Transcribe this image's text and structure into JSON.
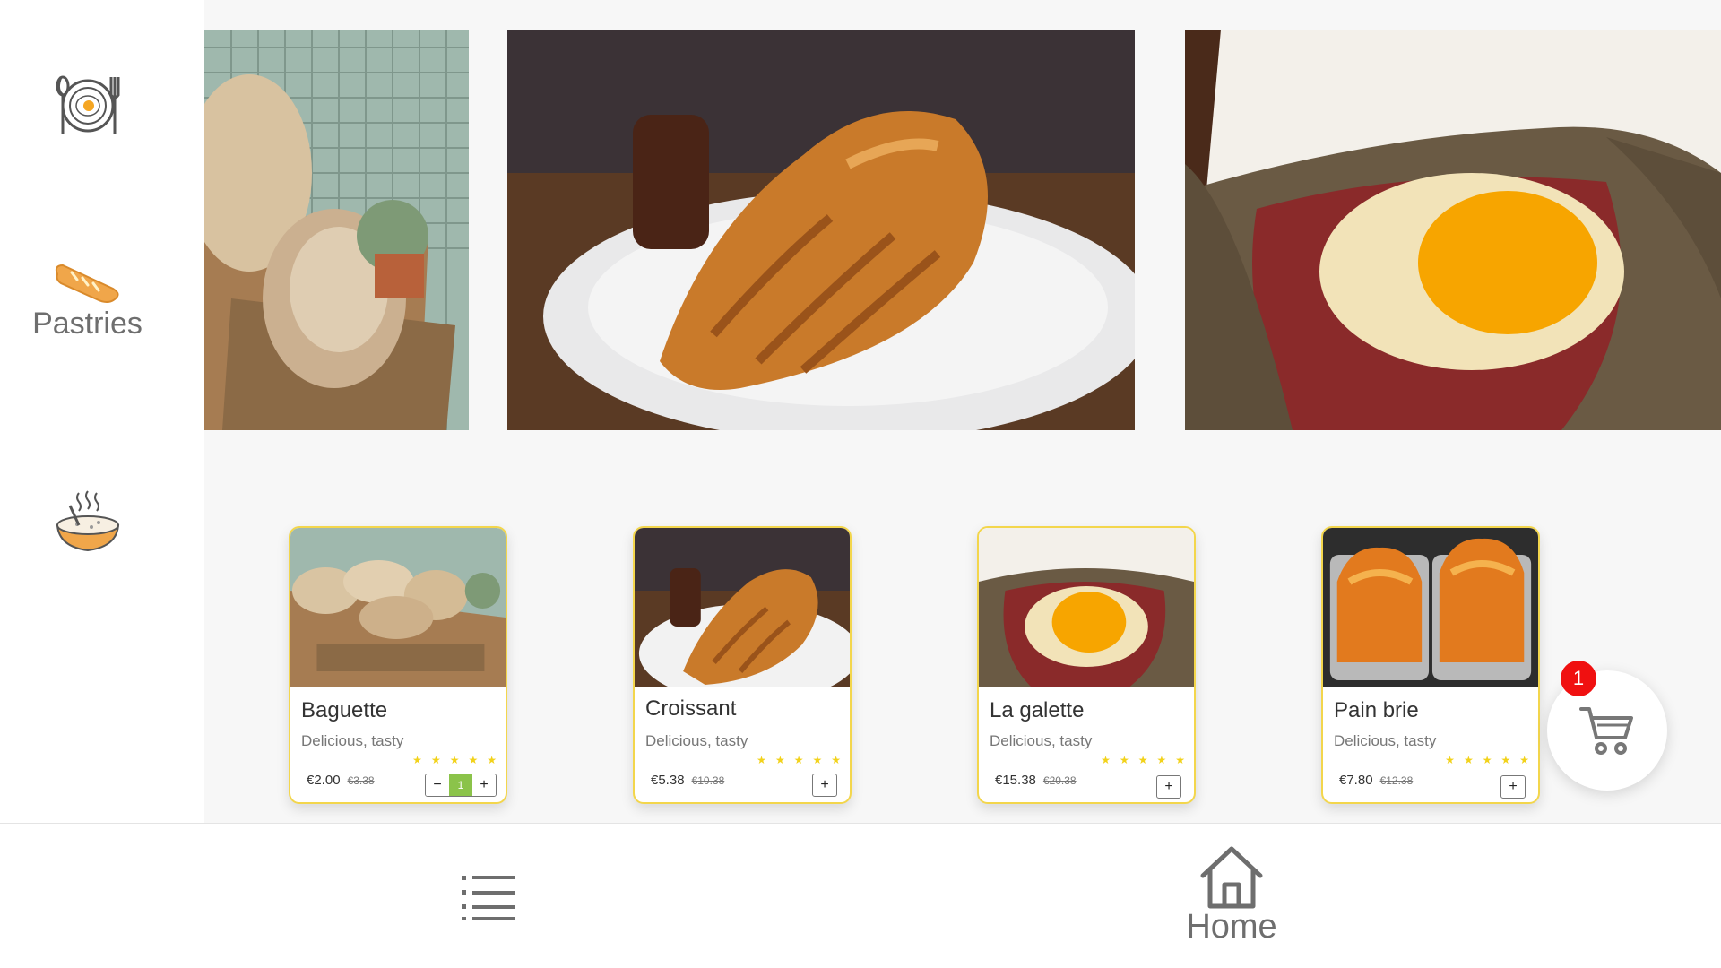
{
  "sidebar": {
    "items": [
      {
        "icon": "breakfast-plate-icon",
        "label": ""
      },
      {
        "icon": "bread-icon",
        "label": "Pastries"
      },
      {
        "icon": "soup-bowl-icon",
        "label": ""
      }
    ]
  },
  "banner": {
    "images": [
      {
        "subject": "bread-basket-photo"
      },
      {
        "subject": "croissant-photo"
      },
      {
        "subject": "galette-photo"
      }
    ]
  },
  "products": [
    {
      "name": "Baguette",
      "description": "Delicious, tasty",
      "price": "€2.00",
      "old_price": "€3.38",
      "rating": 5,
      "quantity": "1",
      "minus": "−",
      "plus": "+"
    },
    {
      "name": "Croissant",
      "description": "Delicious, tasty",
      "price": "€5.38",
      "old_price": "€10.38",
      "rating": 5,
      "plus": "+"
    },
    {
      "name": "La galette",
      "description": "Delicious, tasty",
      "price": "€15.38",
      "old_price": "€20.38",
      "rating": 5,
      "plus": "+"
    },
    {
      "name": "Pain brie",
      "description": "Delicious, tasty",
      "price": "€7.80",
      "old_price": "€12.38",
      "rating": 5,
      "plus": "+"
    }
  ],
  "cart": {
    "count": "1",
    "icon": "cart-icon"
  },
  "bottom_nav": {
    "menu_icon": "list-icon",
    "home_icon": "home-icon",
    "home_label": "Home"
  },
  "colors": {
    "card_border": "#f3d64c",
    "star": "#f2d21a",
    "qty_active": "#8bc34a",
    "badge": "#f01010",
    "icon_gray": "#6e6e6e"
  }
}
